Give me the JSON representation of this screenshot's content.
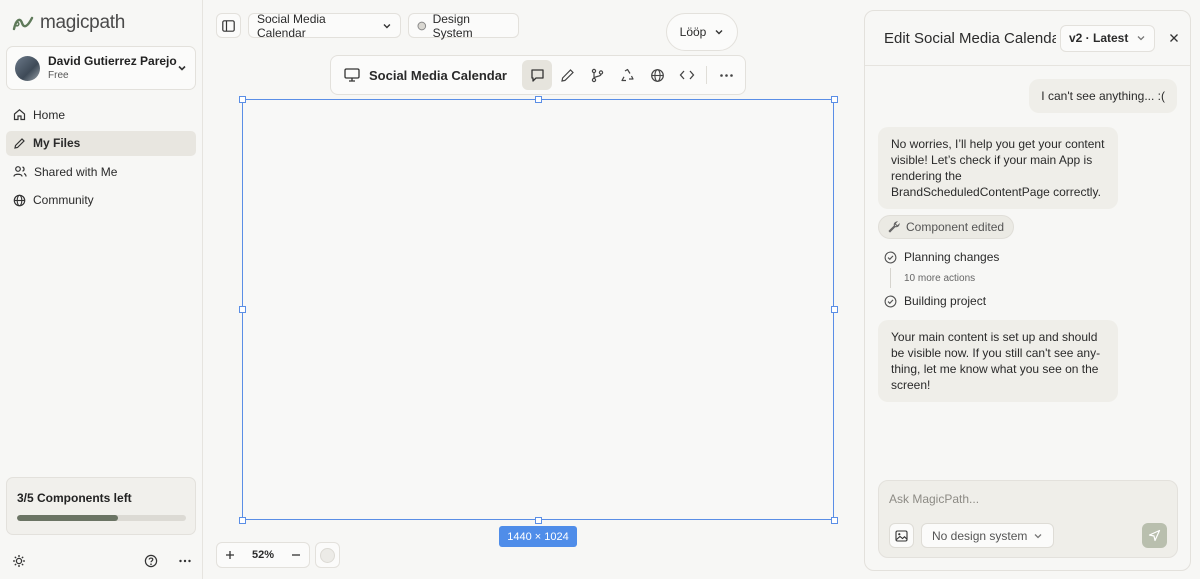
{
  "sidebar": {
    "logo": "magicpath",
    "account": {
      "name": "David Gutierrez Parejo",
      "plan": "Free"
    },
    "nav": [
      {
        "label": "Home",
        "icon": "home-icon"
      },
      {
        "label": "My Files",
        "icon": "pencil-icon",
        "active": true
      },
      {
        "label": "Shared with Me",
        "icon": "users-icon"
      },
      {
        "label": "Community",
        "icon": "globe-icon"
      }
    ],
    "quota": {
      "label": "3/5 Components left",
      "used_fraction": 0.6
    }
  },
  "toolbar": {
    "project": "Social Media Calendar",
    "design_system": "Design System",
    "loop": "Lööp"
  },
  "canvas": {
    "title": "Social Media Calendar",
    "dimensions": "1440 × 1024",
    "zoom": "52%"
  },
  "panel": {
    "title": "Edit Social Media Calendar",
    "version": "v2 · Latest",
    "user_message": "I can't see anything... :(",
    "ai_message_1": "No worries, I’ll help you get your content visible! Let’s check if your main App is rendering the BrandScheduledContentPage correctly.",
    "chip": "Component edited",
    "step_1": "Planning changes",
    "more_actions": "10 more actions",
    "step_2": "Building project",
    "ai_message_2": "Your main content is set up and should be visible now. If you still can't see any­thing, let me know what you see on the screen!",
    "composer": {
      "placeholder": "Ask MagicPath...",
      "design_system": "No design system"
    }
  },
  "colors": {
    "accent": "#4f8de9",
    "send": "#b9bfae",
    "progress": "#6b7464"
  }
}
